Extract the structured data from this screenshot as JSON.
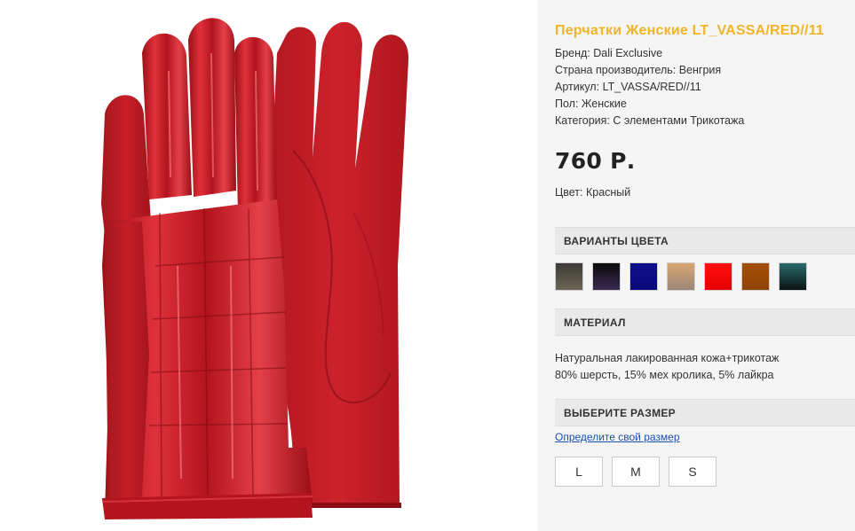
{
  "product": {
    "title": "Перчатки Женские LT_VASSA/RED//11",
    "title_color": "#f0b429",
    "specs": [
      {
        "label": "Бренд:",
        "value": "Dali Exclusive"
      },
      {
        "label": "Страна производитель:",
        "value": "Венгрия"
      },
      {
        "label": "Артикул:",
        "value": "LT_VASSA/RED//11"
      },
      {
        "label": "Пол:",
        "value": "Женские"
      },
      {
        "label": "Категория:",
        "value": "С элементами Трикотажа"
      }
    ],
    "price": "760 Р.",
    "color_label": "Цвет:",
    "color_value": "Красный"
  },
  "color_variants": {
    "heading": "ВАРИАНТЫ ЦВЕТА",
    "swatches": [
      {
        "name": "dark-olive",
        "top": "#3b3a36",
        "bottom": "#6b6553"
      },
      {
        "name": "black-purple",
        "top": "#0a0a0a",
        "bottom": "#3a2a52"
      },
      {
        "name": "navy-blue",
        "top": "#0e0e8c",
        "bottom": "#0a0a7a"
      },
      {
        "name": "beige",
        "top": "#d9a673",
        "bottom": "#9a8677"
      },
      {
        "name": "red",
        "top": "#ff1010",
        "bottom": "#e60000"
      },
      {
        "name": "brown",
        "top": "#a34f06",
        "bottom": "#8f4304"
      },
      {
        "name": "teal-black",
        "top": "#2a6b6b",
        "bottom": "#0b1212"
      }
    ]
  },
  "material": {
    "heading": "МАТЕРИАЛ",
    "line1": "Натуральная лакированная кожа+трикотаж",
    "line2": "80% шерсть, 15% мех кролика, 5% лайкра"
  },
  "size": {
    "heading": "ВЫБЕРИТЕ РАЗМЕР",
    "guide_link": "Определите свой размер",
    "options": [
      "L",
      "M",
      "S"
    ]
  },
  "image": {
    "subject": "red-gloves-photo",
    "glove_color": "#c81d25",
    "glove_shadow": "#8f1016"
  }
}
